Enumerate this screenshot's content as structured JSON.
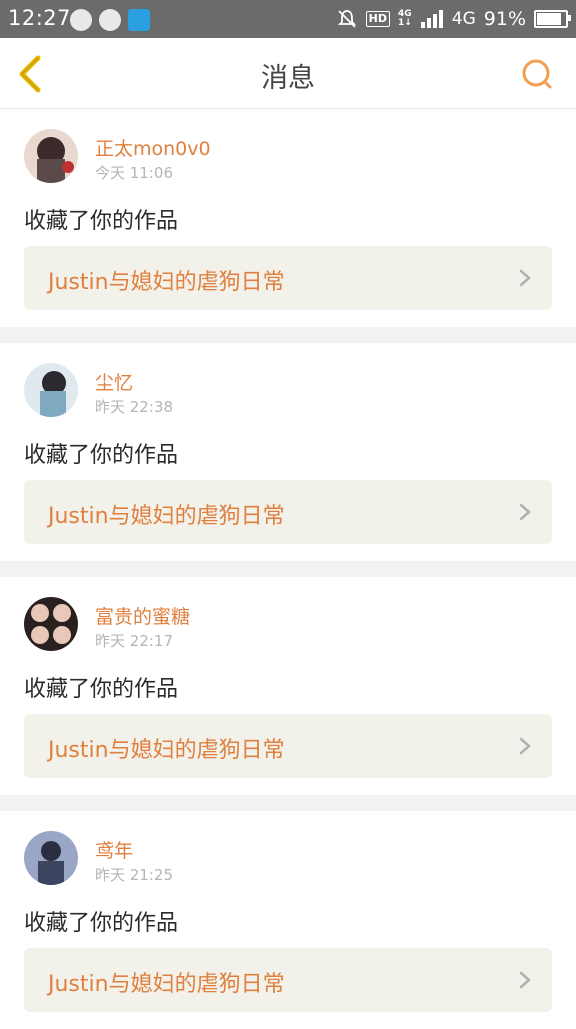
{
  "status_bar": {
    "time": "12:27",
    "hd": "HD",
    "network_small": [
      "4G",
      "1↓"
    ],
    "network": "4G",
    "battery_pct": "91%",
    "battery_level": 0.91
  },
  "header": {
    "title": "消息"
  },
  "colors": {
    "accent": "#e07f3e",
    "back_icon": "#e6b800",
    "work_bg": "#f2f2ea"
  },
  "notifications": [
    {
      "user": "正太mon0v0",
      "time": "今天 11:06",
      "action": "收藏了你的作品",
      "work_title": "Justin与媳妇的虐狗日常",
      "avatar_colors": [
        "#3b2b2b",
        "#e8d8d0"
      ]
    },
    {
      "user": "尘忆",
      "time": "昨天 22:38",
      "action": "收藏了你的作品",
      "work_title": "Justin与媳妇的虐狗日常",
      "avatar_colors": [
        "#7fa9c0",
        "#dfe9ee"
      ]
    },
    {
      "user": "富贵的蜜糖",
      "time": "昨天 22:17",
      "action": "收藏了你的作品",
      "work_title": "Justin与媳妇的虐狗日常",
      "avatar_colors": [
        "#2a2020",
        "#e8c8b8"
      ]
    },
    {
      "user": "鸢年",
      "time": "昨天 21:25",
      "action": "收藏了你的作品",
      "work_title": "Justin与媳妇的虐狗日常",
      "avatar_colors": [
        "#3b4560",
        "#9aa6c6"
      ]
    }
  ]
}
